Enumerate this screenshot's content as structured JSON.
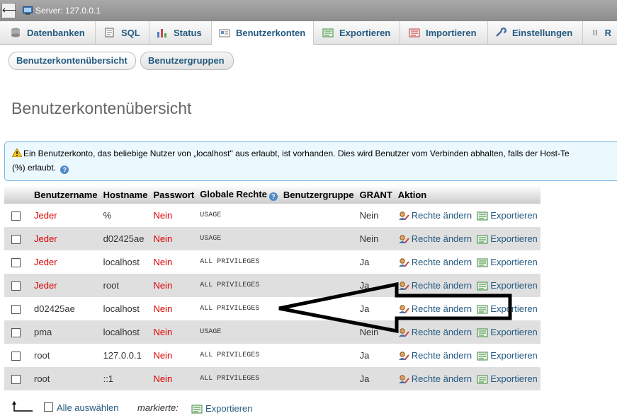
{
  "window": {
    "back_symbol": "⟵",
    "title": "Server: 127.0.0.1"
  },
  "tabs": [
    {
      "label": "Datenbanken",
      "icon": "database-icon"
    },
    {
      "label": "SQL",
      "icon": "sql-icon"
    },
    {
      "label": "Status",
      "icon": "status-chart-icon"
    },
    {
      "label": "Benutzerkonten",
      "icon": "user-accounts-icon",
      "active": true
    },
    {
      "label": "Exportieren",
      "icon": "export-icon"
    },
    {
      "label": "Importieren",
      "icon": "import-icon"
    },
    {
      "label": "Einstellungen",
      "icon": "wrench-icon"
    },
    {
      "label": "R",
      "icon": "replication-icon"
    }
  ],
  "subtabs": [
    "Benutzerkontenübersicht",
    "Benutzergruppen"
  ],
  "page_title": "Benutzerkontenübersicht",
  "notice": {
    "line1": "Ein Benutzerkonto, das beliebige Nutzer von „localhost\" aus erlaubt, ist vorhanden. Dies wird Benutzer vom Verbinden abhalten, falls der Host-Te",
    "line2": "(%) erlaubt.",
    "help_symbol": "?"
  },
  "table": {
    "headers": [
      "Benutzername",
      "Hostname",
      "Passwort",
      "Globale Rechte",
      "Benutzergruppe",
      "GRANT",
      "Aktion"
    ],
    "help_symbol": "?",
    "action_edit": "Rechte ändern",
    "action_export": "Exportieren",
    "rows": [
      {
        "user": "Jeder",
        "host": "%",
        "password": "Nein",
        "privileges": "USAGE",
        "group": "",
        "grant": "Nein"
      },
      {
        "user": "Jeder",
        "host": "d02425ae",
        "password": "Nein",
        "privileges": "USAGE",
        "group": "",
        "grant": "Nein"
      },
      {
        "user": "Jeder",
        "host": "localhost",
        "password": "Nein",
        "privileges": "ALL PRIVILEGES",
        "group": "",
        "grant": "Ja"
      },
      {
        "user": "Jeder",
        "host": "root",
        "password": "Nein",
        "privileges": "ALL PRIVILEGES",
        "group": "",
        "grant": "Ja"
      },
      {
        "user": "d02425ae",
        "host": "localhost",
        "password": "Nein",
        "privileges": "ALL PRIVILEGES",
        "group": "",
        "grant": "Ja"
      },
      {
        "user": "pma",
        "host": "localhost",
        "password": "Nein",
        "privileges": "USAGE",
        "group": "",
        "grant": "Nein"
      },
      {
        "user": "root",
        "host": "127.0.0.1",
        "password": "Nein",
        "privileges": "ALL PRIVILEGES",
        "group": "",
        "grant": "Ja"
      },
      {
        "user": "root",
        "host": "::1",
        "password": "Nein",
        "privileges": "ALL PRIVILEGES",
        "group": "",
        "grant": "Ja"
      }
    ]
  },
  "footer": {
    "select_all": "Alle auswählen",
    "marked": "markierte:",
    "export": "Exportieren"
  },
  "colors": {
    "link": "#235a81",
    "red_text": "#dd0000",
    "notice_bg": "#ebf8fd",
    "row_alt": "#dfdfdf"
  }
}
